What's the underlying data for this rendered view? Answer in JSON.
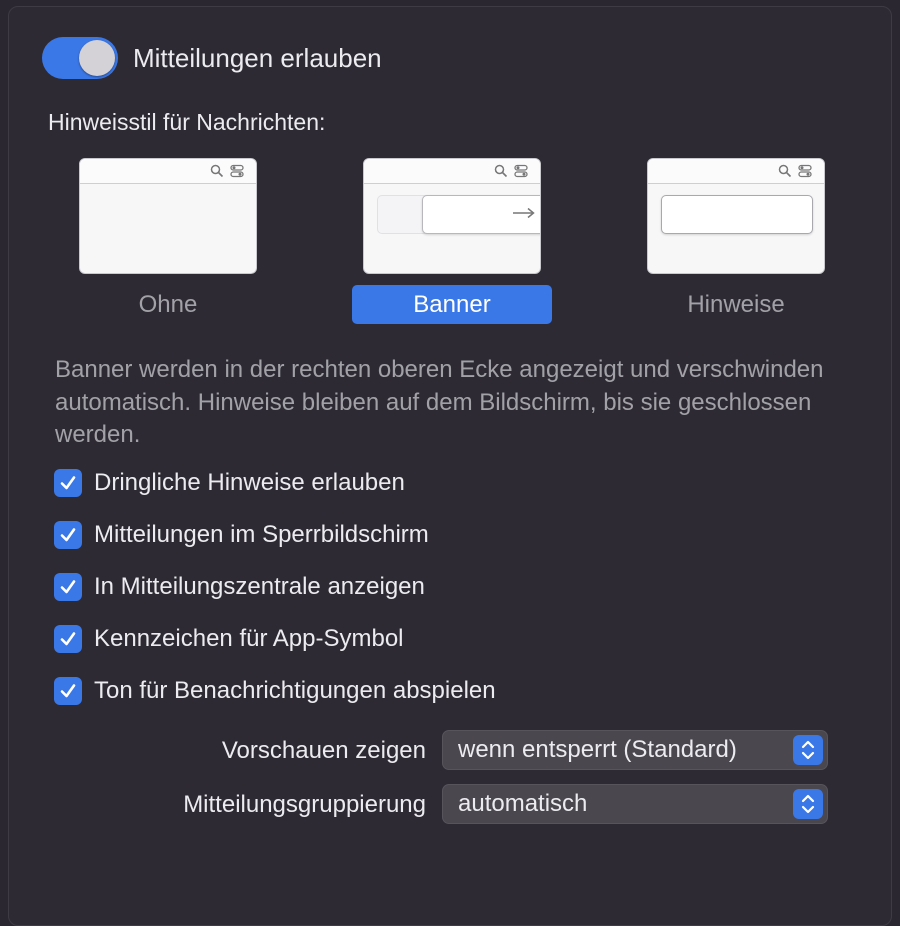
{
  "master": {
    "label": "Mitteilungen erlauben",
    "enabled": true
  },
  "alert_style": {
    "heading": "Hinweisstil für Nachrichten:",
    "options": [
      {
        "label": "Ohne",
        "selected": false
      },
      {
        "label": "Banner",
        "selected": true
      },
      {
        "label": "Hinweise",
        "selected": false
      }
    ],
    "description": "Banner werden in der rechten oberen Ecke angezeigt und verschwinden automatisch. Hinweise bleiben auf dem Bildschirm, bis sie geschlossen werden."
  },
  "checkboxes": [
    {
      "label": "Dringliche Hinweise erlauben",
      "checked": true
    },
    {
      "label": "Mitteilungen im Sperrbildschirm",
      "checked": true
    },
    {
      "label": "In Mitteilungszentrale anzeigen",
      "checked": true
    },
    {
      "label": "Kennzeichen für App-Symbol",
      "checked": true
    },
    {
      "label": "Ton für Benachrichtigungen abspielen",
      "checked": true
    }
  ],
  "selects": {
    "previews": {
      "label": "Vorschauen zeigen",
      "value": "wenn entsperrt (Standard)"
    },
    "grouping": {
      "label": "Mitteilungsgruppierung",
      "value": "automatisch"
    }
  },
  "colors": {
    "accent": "#3b78e7",
    "background": "#2d2a33",
    "muted_text": "#a3a1a8"
  }
}
